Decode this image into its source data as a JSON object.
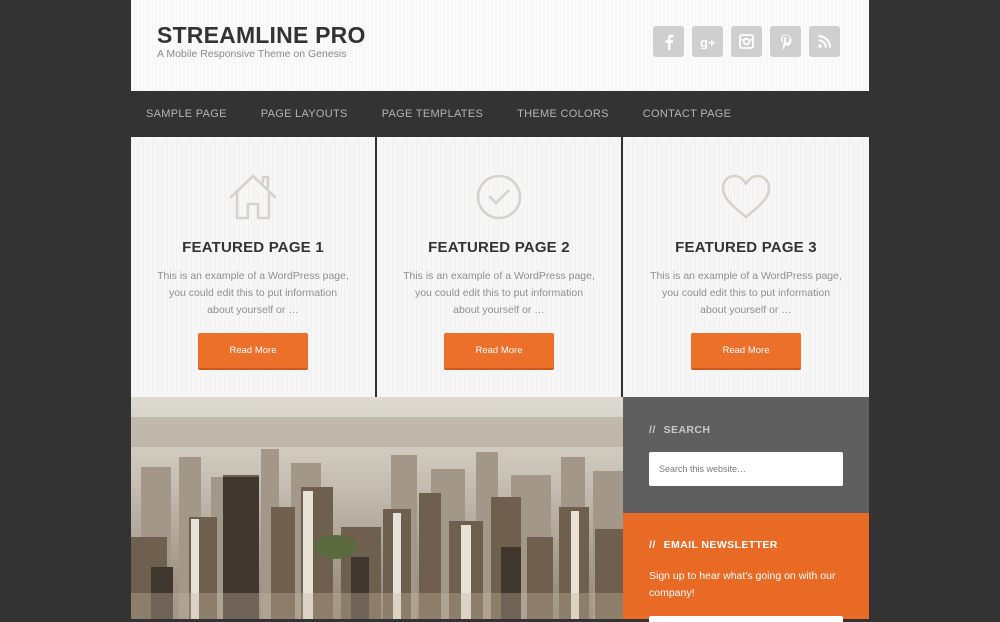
{
  "colors": {
    "accent": "#ec6f2a",
    "dark_background": "#333333",
    "search_widget": "#5f5f5f",
    "newsletter_widget": "#e96a24",
    "icon_gray": "#cfcfcf"
  },
  "header": {
    "title": "STREAMLINE PRO",
    "description": "A Mobile Responsive Theme on Genesis",
    "social_icons": [
      "facebook-icon",
      "google-plus-icon",
      "instagram-icon",
      "pinterest-icon",
      "rss-icon"
    ]
  },
  "nav": {
    "items": [
      {
        "label": "SAMPLE PAGE"
      },
      {
        "label": "PAGE LAYOUTS"
      },
      {
        "label": "PAGE TEMPLATES"
      },
      {
        "label": "THEME COLORS"
      },
      {
        "label": "CONTACT PAGE"
      }
    ]
  },
  "featured": [
    {
      "icon": "home-icon",
      "title": "FEATURED PAGE 1",
      "text": "This is an example of a WordPress page, you could edit this to put information about yourself or …",
      "button": "Read More"
    },
    {
      "icon": "checkmark-circle-icon",
      "title": "FEATURED PAGE 2",
      "text": "This is an example of a WordPress page, you could edit this to put information about yourself or …",
      "button": "Read More"
    },
    {
      "icon": "heart-icon",
      "title": "FEATURED PAGE 3",
      "text": "This is an example of a WordPress page, you could edit this to put information about yourself or …",
      "button": "Read More"
    }
  ],
  "sidebar": {
    "search": {
      "slashes": "//",
      "title": "SEARCH",
      "placeholder": "Search this website…"
    },
    "newsletter": {
      "slashes": "//",
      "title": "EMAIL NEWSLETTER",
      "text": "Sign up to hear what's going on with our company!"
    }
  }
}
